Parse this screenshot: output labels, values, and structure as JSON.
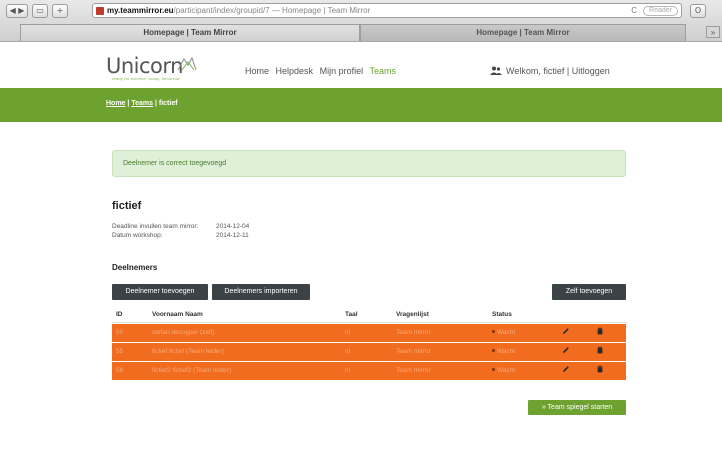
{
  "browser": {
    "url_host": "my.teammirror.eu",
    "url_path": "/participant/index/groupid/7 — Homepage | Team Mirror",
    "reader_label": "Reader",
    "tabs": [
      {
        "label": "Homepage | Team Mirror",
        "active": true
      },
      {
        "label": "Homepage | Team Mirror",
        "active": false
      }
    ]
  },
  "header": {
    "logo_text": "Unicorn",
    "logo_tagline": "ready for science, today, tomorrow",
    "nav": [
      {
        "label": "Home",
        "active": false
      },
      {
        "label": "Helpdesk",
        "active": false
      },
      {
        "label": "Mijn profiel",
        "active": false
      },
      {
        "label": "Teams",
        "active": true
      }
    ],
    "welcome": "Welkom, fictief",
    "separator": "|",
    "logout": "Uitloggen"
  },
  "breadcrumb": {
    "home": "Home",
    "sep": "|",
    "teams": "Teams",
    "current": "fictief"
  },
  "alert": {
    "text": "Deelnemer is correct toegevoegd"
  },
  "group": {
    "title": "fictief",
    "deadline_label": "Deadline invullen team mirror:",
    "deadline_value": "2014-12-04",
    "workshop_label": "Datum workshop:",
    "workshop_value": "2014-12-11"
  },
  "participants": {
    "title": "Deelnemers",
    "add_button": "Deelnemer toevoegen",
    "import_button": "Deelnemers importeren",
    "self_button": "Zelf toevoegen",
    "columns": {
      "id": "ID",
      "name": "Voornaam Naam",
      "taal": "Taal",
      "vragenlijst": "Vragenlijst",
      "status": "Status"
    },
    "rows": [
      {
        "id": "50",
        "name": "stefan decuyper (zelf)",
        "taal": "nl",
        "vragenlijst": "Team mirror",
        "status": "Wacht"
      },
      {
        "id": "55",
        "name": "fictief fictief (Team leider)",
        "taal": "nl",
        "vragenlijst": "Team mirror",
        "status": "Wacht"
      },
      {
        "id": "56",
        "name": "fictief2 fictief2 (Team leider)",
        "taal": "nl",
        "vragenlijst": "Team mirror",
        "status": "Wacht"
      }
    ]
  },
  "start_button": "» Team spiegel starten",
  "colors": {
    "brand_green": "#6ea230",
    "row_orange": "#f26c1f",
    "dark_button": "#3b4346",
    "alert_bg": "#dff0d8"
  }
}
